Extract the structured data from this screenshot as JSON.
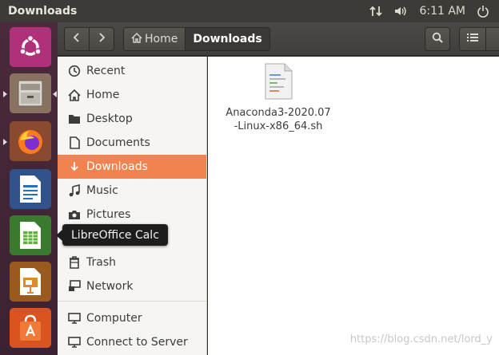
{
  "topbar": {
    "title": "Downloads",
    "time": "6:11 AM",
    "icons": [
      "network-arrows-icon",
      "volume-icon",
      "power-icon"
    ]
  },
  "launcher": {
    "items": [
      "ubuntu-logo-icon",
      "files-app-icon",
      "firefox-icon",
      "libreoffice-writer-icon",
      "libreoffice-calc-icon",
      "libreoffice-impress-icon",
      "software-center-icon"
    ],
    "tooltip": "LibreOffice Calc"
  },
  "headerbar": {
    "breadcrumbs": [
      "Home",
      "Downloads"
    ],
    "icons": [
      "back-arrow-icon",
      "forward-arrow-icon",
      "home-icon",
      "search-icon",
      "list-view-icon"
    ]
  },
  "sidebar": {
    "items": [
      {
        "label": "Recent",
        "icon": "clock-icon"
      },
      {
        "label": "Home",
        "icon": "home-icon"
      },
      {
        "label": "Desktop",
        "icon": "folder-icon"
      },
      {
        "label": "Documents",
        "icon": "document-icon"
      },
      {
        "label": "Downloads",
        "icon": "download-arrow-icon"
      },
      {
        "label": "Music",
        "icon": "music-note-icon"
      },
      {
        "label": "Pictures",
        "icon": "camera-icon"
      },
      {
        "label": "Trash",
        "icon": "trash-icon"
      },
      {
        "label": "Network",
        "icon": "network-icon"
      },
      {
        "label": "Computer",
        "icon": "computer-icon"
      },
      {
        "label": "Connect to Server",
        "icon": "server-icon"
      }
    ],
    "active": "Downloads"
  },
  "content": {
    "files": [
      {
        "name": "Anaconda3-2020.07-Linux-x86_64.sh",
        "icon": "shell-script-icon"
      }
    ]
  },
  "watermark": "https://blog.csdn.net/lord_y",
  "colors": {
    "accent": "#f0834f",
    "launcher": "#4a2a3b",
    "topbar": "#3c3b37"
  }
}
